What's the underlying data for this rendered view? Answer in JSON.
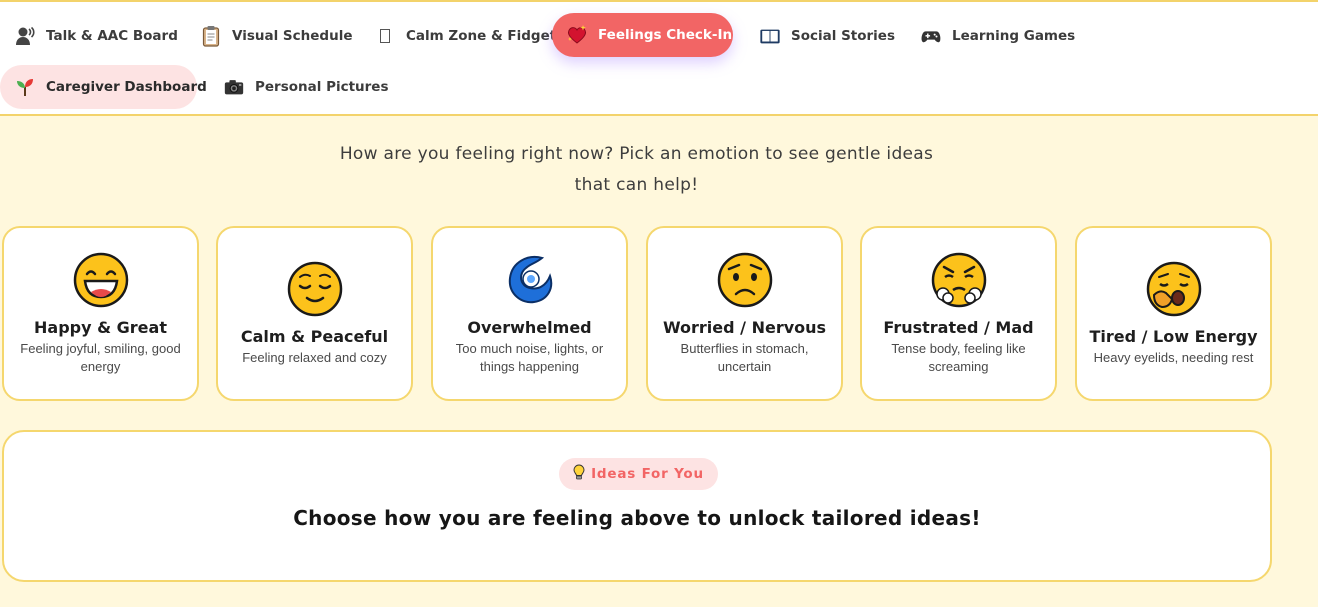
{
  "nav": {
    "tabs": [
      {
        "label": "Talk & AAC Board",
        "icon": "person-speaking-icon"
      },
      {
        "label": "Visual Schedule",
        "icon": "clipboard-icon"
      },
      {
        "label": "Calm Zone & Fidgets",
        "icon": "missing-glyph-icon"
      },
      {
        "label": "Feelings Check-In",
        "icon": "heart-sparkle-icon",
        "active": true
      },
      {
        "label": "Social Stories",
        "icon": "open-book-icon"
      },
      {
        "label": "Learning Games",
        "icon": "game-controller-icon"
      },
      {
        "label": "Caregiver Dashboard",
        "icon": "seedling-icon"
      },
      {
        "label": "Personal Pictures",
        "icon": "camera-icon"
      }
    ]
  },
  "intro": {
    "line1": "How are you feeling right now? Pick an emotion to see gentle ideas",
    "line2": "that can help!"
  },
  "emotions": [
    {
      "title": "Happy & Great",
      "desc": "Feeling joyful, smiling, good energy",
      "icon": "grinning-face-icon"
    },
    {
      "title": "Calm & Peaceful",
      "desc": "Feeling relaxed and cozy",
      "icon": "relieved-face-icon"
    },
    {
      "title": "Overwhelmed",
      "desc": "Too much noise, lights, or things happening",
      "icon": "cyclone-icon"
    },
    {
      "title": "Worried / Nervous",
      "desc": "Butterflies in stomach, uncertain",
      "icon": "worried-face-icon"
    },
    {
      "title": "Frustrated / Mad",
      "desc": "Tense body, feeling like screaming",
      "icon": "steaming-face-icon"
    },
    {
      "title": "Tired / Low Energy",
      "desc": "Heavy eyelids, needing rest",
      "icon": "yawning-face-icon"
    }
  ],
  "ideas": {
    "badge": "Ideas For You",
    "badge_icon": "lightbulb-icon",
    "message": "Choose how you are feeling above to unlock tailored ideas!"
  },
  "colors": {
    "background": "#fff8dc",
    "accent": "#f26565",
    "card_border": "#f5d76e",
    "soft_pink": "#fde3e3"
  }
}
